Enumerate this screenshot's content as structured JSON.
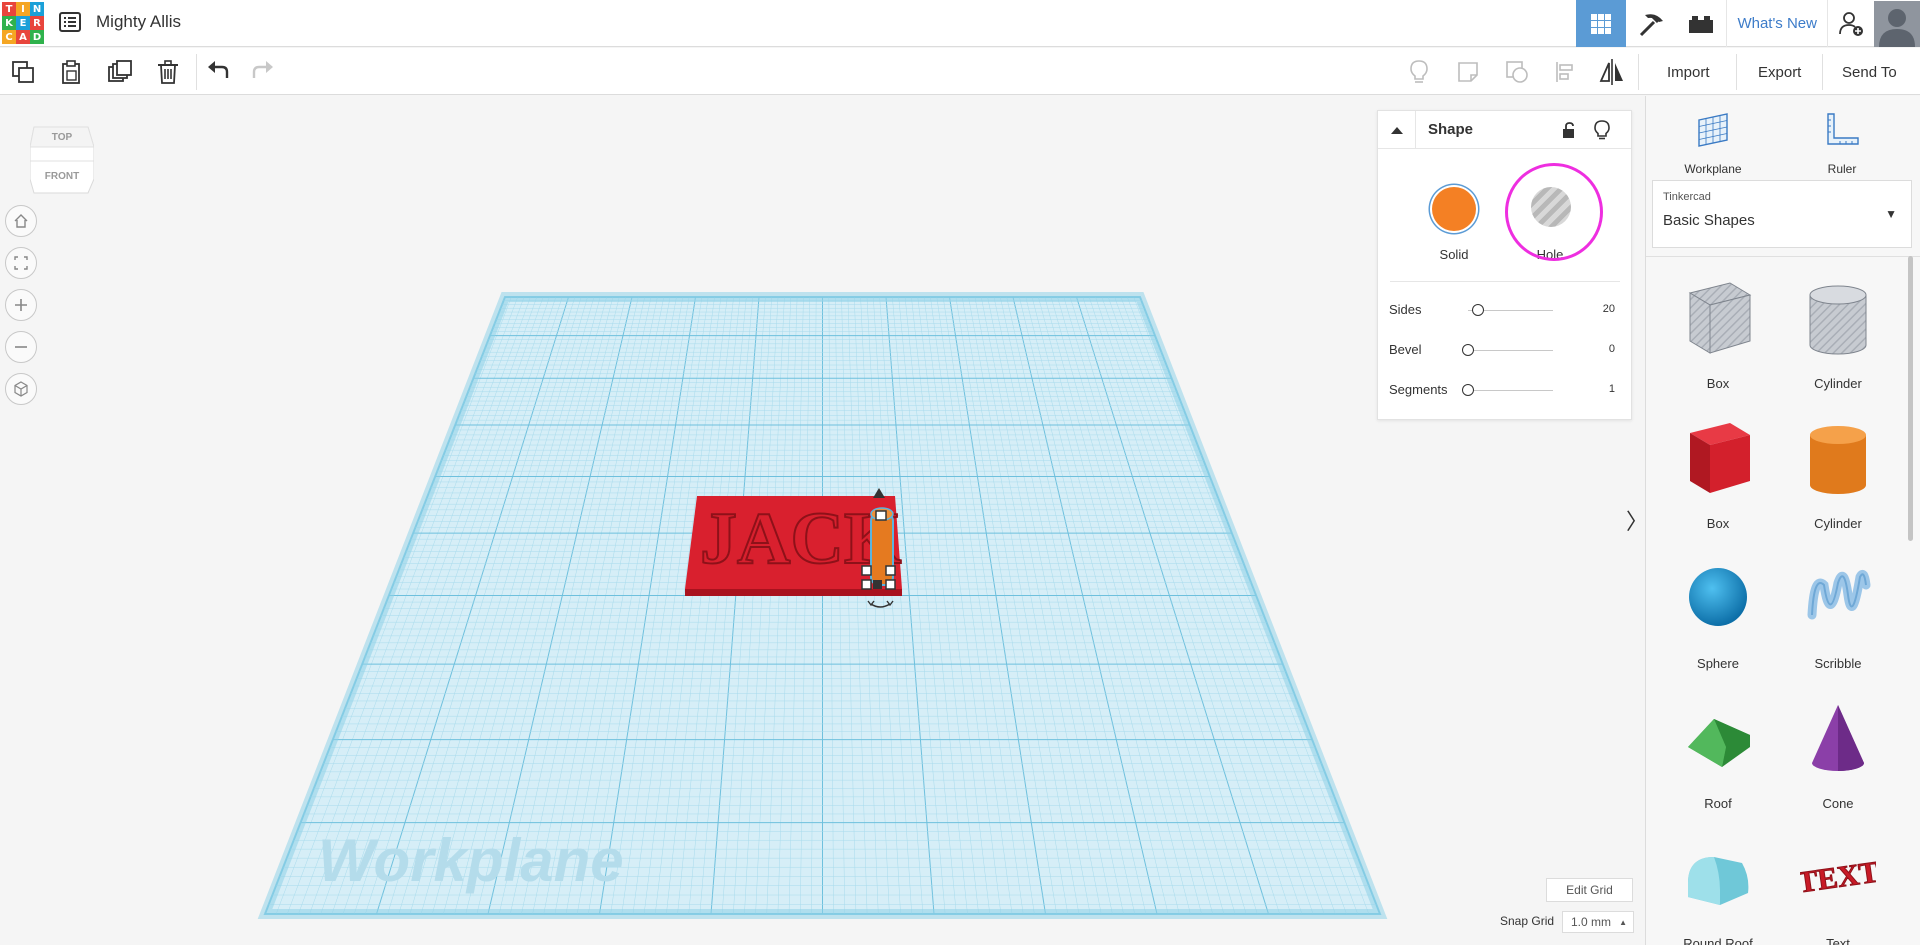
{
  "app": {
    "logo_letters": [
      "T",
      "I",
      "N",
      "K",
      "E",
      "R",
      "C",
      "A",
      "D"
    ],
    "logo_colors": [
      "#e8453c",
      "#f5a623",
      "#1aa0d8",
      "#2fb24c",
      "#1aa0d8",
      "#e8453c",
      "#f5a623",
      "#e8453c",
      "#2fb24c"
    ],
    "design_title": "Mighty Allis"
  },
  "topbar": {
    "icons": [
      "grid-view-icon",
      "pickaxe-icon",
      "brick-icon"
    ],
    "whats_new": "What's New",
    "accent": "#5b9bd5"
  },
  "toolbar": {
    "left_icons": [
      "copy-icon",
      "paste-icon",
      "duplicate-icon",
      "delete-icon",
      "undo-icon",
      "redo-icon"
    ],
    "right_icons": [
      "light-bulb-icon",
      "note-icon",
      "group-icon",
      "align-icon",
      "mirror-icon"
    ],
    "import_label": "Import",
    "export_label": "Export",
    "send_to_label": "Send To"
  },
  "viewcube": {
    "top": "TOP",
    "front": "FRONT"
  },
  "nav_buttons": [
    "home-icon",
    "fit-view-icon",
    "zoom-in-icon",
    "zoom-out-icon",
    "orthographic-icon"
  ],
  "inspector": {
    "title": "Shape",
    "solid_label": "Solid",
    "hole_label": "Hole",
    "solid_color": "#f48024",
    "sliders": [
      {
        "label": "Sides",
        "value": "20",
        "level": 0.12
      },
      {
        "label": "Bevel",
        "value": "0",
        "level": 0
      },
      {
        "label": "Segments",
        "value": "1",
        "level": 0
      }
    ]
  },
  "workplane": {
    "watermark": "Workplane",
    "object_text": "JACK",
    "object_color": "#d9202e"
  },
  "grid_controls": {
    "edit_grid": "Edit Grid",
    "snap_label": "Snap Grid",
    "snap_value": "1.0 mm"
  },
  "right_panel": {
    "workplane_label": "Workplane",
    "ruler_label": "Ruler",
    "library_small": "Tinkercad",
    "library_name": "Basic Shapes",
    "shapes": [
      {
        "label": "Box",
        "icon": "box-hole-icon"
      },
      {
        "label": "Cylinder",
        "icon": "cylinder-hole-icon"
      },
      {
        "label": "Box",
        "icon": "box-red-icon"
      },
      {
        "label": "Cylinder",
        "icon": "cylinder-orange-icon"
      },
      {
        "label": "Sphere",
        "icon": "sphere-icon"
      },
      {
        "label": "Scribble",
        "icon": "scribble-icon"
      },
      {
        "label": "Roof",
        "icon": "roof-icon"
      },
      {
        "label": "Cone",
        "icon": "cone-icon"
      },
      {
        "label": "Round Roof",
        "icon": "round-roof-icon"
      },
      {
        "label": "Text",
        "icon": "text-icon"
      }
    ]
  }
}
